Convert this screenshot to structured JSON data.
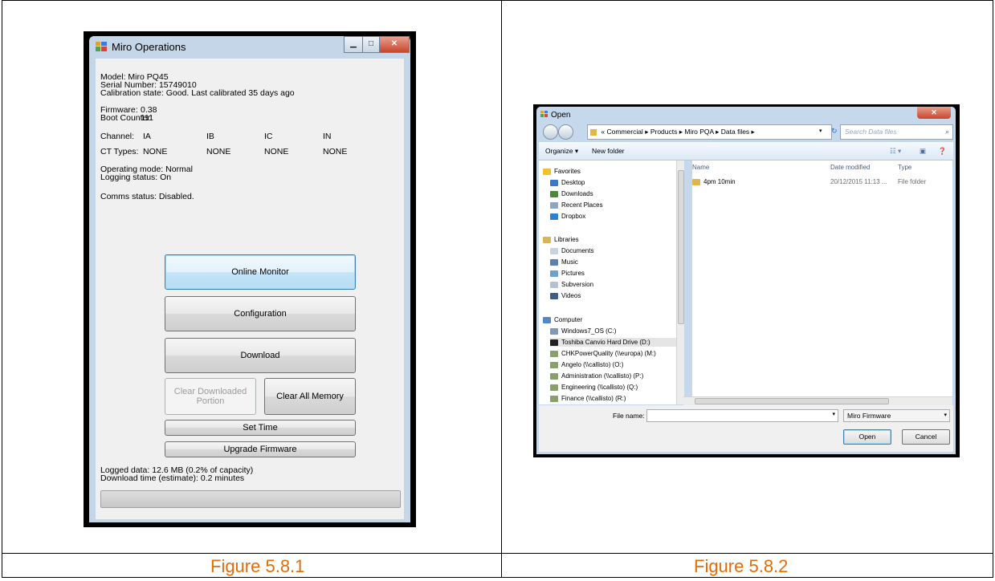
{
  "figures": [
    {
      "caption": "Figure 5.8.1"
    },
    {
      "caption": "Figure 5.8.2"
    }
  ],
  "miro": {
    "title": "Miro Operations",
    "info_lines": [
      "Model: Miro PQ45",
      "Serial Number: 15749010",
      "Calibration state: Good. Last calibrated 35 days ago"
    ],
    "firmware_label": "Firmware:",
    "firmware_value": "0.38",
    "boot_label": "Boot Counter:",
    "boot_value": "111",
    "channel_label": "Channel:",
    "channels": [
      "IA",
      "IB",
      "IC",
      "IN"
    ],
    "ct_label": "CT Types:",
    "ct_types": [
      "NONE",
      "NONE",
      "NONE",
      "NONE"
    ],
    "operating_mode": "Operating mode: Normal",
    "logging_status": "Logging status: On",
    "comms_status": "Comms status: Disabled.",
    "buttons": {
      "online_monitor": "Online Monitor",
      "configuration": "Configuration",
      "download": "Download",
      "clear_downloaded_line1": "Clear Downloaded",
      "clear_downloaded_line2": "Portion",
      "clear_all": "Clear All Memory",
      "set_time": "Set Time",
      "upgrade_firmware": "Upgrade Firmware"
    },
    "logged_data": "Logged data: 12.6 MB (0.2% of capacity)",
    "download_time": "Download time (estimate): 0.2 minutes",
    "progress": 0
  },
  "open_dialog": {
    "title": "Open",
    "breadcrumb": [
      "«",
      "Commercial",
      "Products",
      "Miro PQA",
      "Data files"
    ],
    "search_placeholder": "Search Data files",
    "organize": "Organize ▾",
    "new_folder": "New folder",
    "favorites_header": "Favorites",
    "favorites": [
      "Desktop",
      "Downloads",
      "Recent Places",
      "Dropbox"
    ],
    "libraries_header": "Libraries",
    "libraries": [
      "Documents",
      "Music",
      "Pictures",
      "Subversion",
      "Videos"
    ],
    "computer_header": "Computer",
    "computer": [
      "Windows7_OS (C:)",
      "Toshiba Canvio Hard Drive (D:)",
      "CHKPowerQuality (\\\\europa) (M:)",
      "Angelo (\\\\callisto) (O:)",
      "Administration (\\\\callisto) (P:)",
      "Engineering (\\\\callisto) (Q:)",
      "Finance (\\\\callisto) (R:)"
    ],
    "columns": [
      "Name",
      "Date modified",
      "Type"
    ],
    "files": [
      {
        "name": "4pm 10min",
        "date": "20/12/2015 11:13 ...",
        "type": "File folder"
      }
    ],
    "file_name_label": "File name:",
    "file_name_value": "",
    "filter": "Miro Firmware",
    "open_button": "Open",
    "cancel_button": "Cancel"
  }
}
